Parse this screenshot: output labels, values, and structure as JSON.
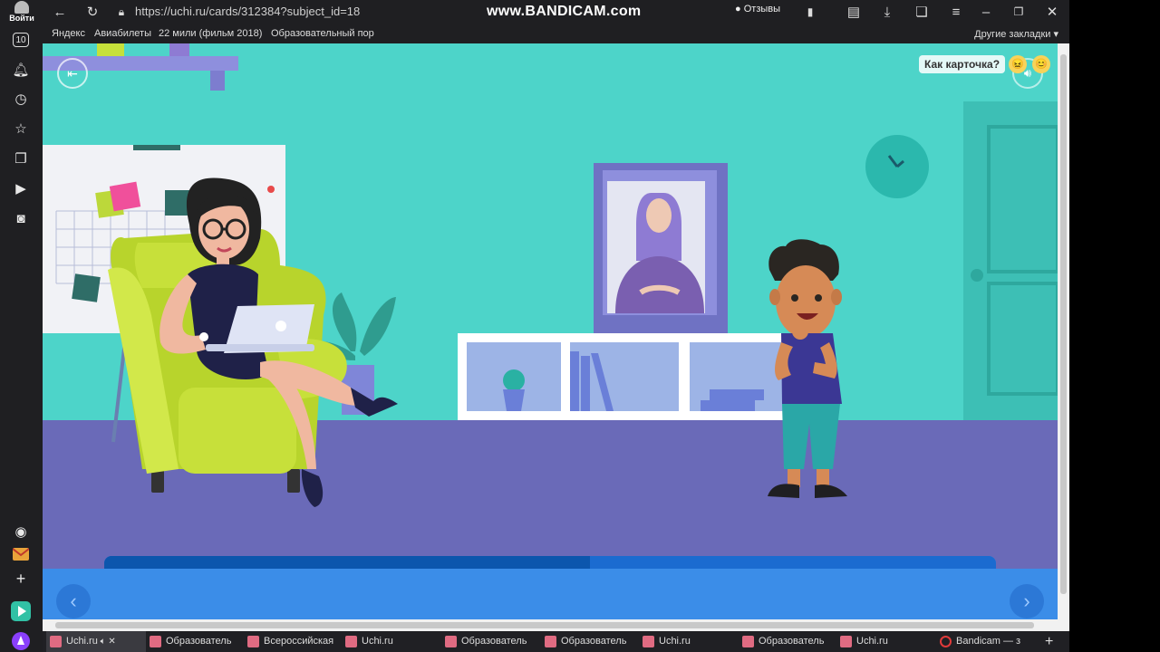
{
  "browser": {
    "url": "https://uchi.ru/cards/312384?subject_id=18",
    "watermark": "www.BANDICAM.com",
    "reviews_label": "Отзывы",
    "login_label": "Войти",
    "tab_counter": "10"
  },
  "bookmarks": {
    "items": [
      "Яндекс",
      "Авиабилеты",
      "22 мили (фильм 2018)",
      "Образовательный пор"
    ],
    "other": "Другие закладки"
  },
  "lesson": {
    "rate_prompt": "Как карточка?",
    "emojis": [
      "😖",
      "😊"
    ],
    "progress": 0.545,
    "colors": {
      "wall": "#4dd4c9",
      "floor": "#6a6ab8",
      "progress_track": "#1b6bd0",
      "progress_fill": "#0c56ad",
      "nav_panel": "#3b8de8"
    }
  },
  "taskbar": {
    "tabs": [
      {
        "label": "Uchi.ru",
        "active": true
      },
      {
        "label": "Образователь"
      },
      {
        "label": "Всероссийская"
      },
      {
        "label": "Uchi.ru"
      },
      {
        "label": "Образователь"
      },
      {
        "label": "Образователь"
      },
      {
        "label": "Uchi.ru"
      },
      {
        "label": "Образователь"
      },
      {
        "label": "Uchi.ru"
      },
      {
        "label": "Bandicam — з"
      }
    ]
  }
}
